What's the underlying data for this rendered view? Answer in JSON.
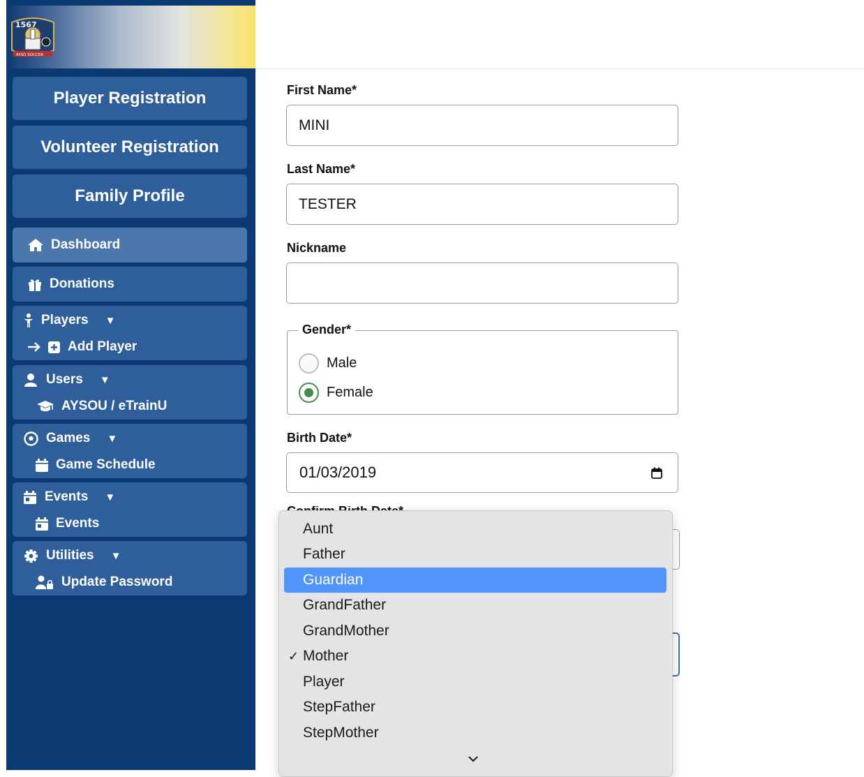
{
  "sidebar": {
    "logo_text": "1567 AYSO SOCCER",
    "buttons": [
      "Player Registration",
      "Volunteer Registration",
      "Family Profile"
    ],
    "dashboard": "Dashboard",
    "donations": "Donations",
    "players": {
      "label": "Players",
      "sub": "Add Player"
    },
    "users": {
      "label": "Users",
      "sub": "AYSOU / eTrainU"
    },
    "games": {
      "label": "Games",
      "sub": "Game Schedule"
    },
    "events": {
      "label": "Events",
      "sub": "Events"
    },
    "utilities": {
      "label": "Utilities",
      "sub": "Update Password"
    },
    "caret": "▼"
  },
  "form": {
    "first_name_label": "First Name*",
    "first_name_value": "MINI",
    "last_name_label": "Last Name*",
    "last_name_value": "TESTER",
    "nickname_label": "Nickname",
    "nickname_value": "",
    "gender_label": "Gender*",
    "gender_options": [
      "Male",
      "Female"
    ],
    "gender_selected": "Female",
    "birth_date_label": "Birth Date*",
    "birth_date_value": "01/03/2019",
    "confirm_birth_date_label": "Confirm Birth Date*"
  },
  "dropdown": {
    "options": [
      "Aunt",
      "Father",
      "Guardian",
      "GrandFather",
      "GrandMother",
      "Mother",
      "Player",
      "StepFather",
      "StepMother"
    ],
    "highlighted": "Guardian",
    "checked": "Mother",
    "check_mark": "✓"
  },
  "colors": {
    "sidebar_bg": "#0b3a73",
    "nav_item": "#2f5f9a",
    "nav_active": "#4c77ad",
    "highlight": "#5195fb",
    "radio_checked": "#4a8a52"
  }
}
